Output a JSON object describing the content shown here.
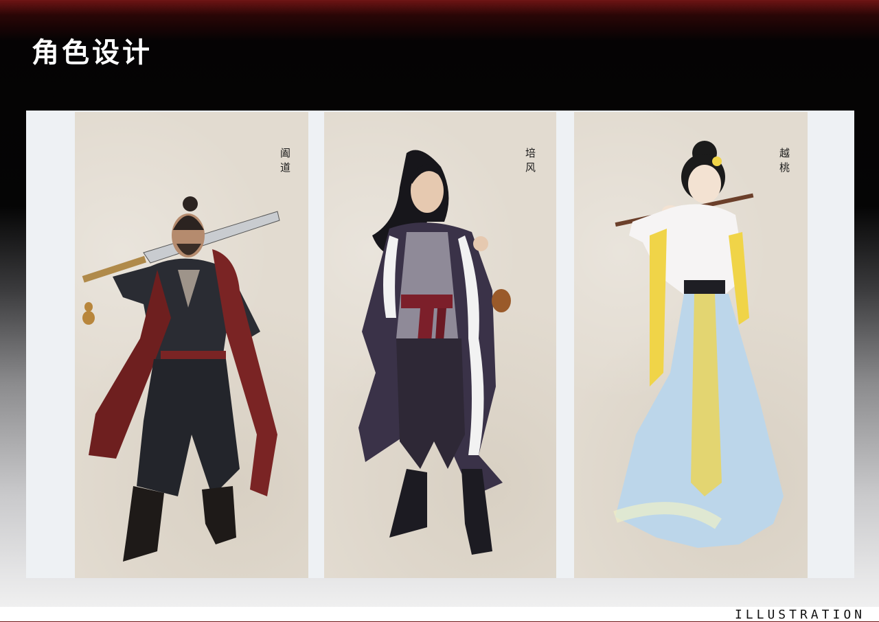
{
  "header": {
    "title": "角色设计"
  },
  "characters": [
    {
      "name": "阖道",
      "palette": {
        "robe": "#2a2c33",
        "sash": "#7a2424",
        "skin": "#b58b6e"
      }
    },
    {
      "name": "培风",
      "palette": {
        "robe": "#3a3248",
        "sash": "#7c1f2a",
        "fur": "#f2f2f2"
      }
    },
    {
      "name": "越桃",
      "palette": {
        "dress": "#bcd6ea",
        "ribbon": "#f0d448",
        "hair": "#1b1b1b"
      }
    }
  ],
  "footer": {
    "label": "ILLUSTRATION"
  },
  "colors": {
    "header_red": "#6e1414",
    "paper": "#e2dbd0",
    "panel": "#eef1f4"
  }
}
